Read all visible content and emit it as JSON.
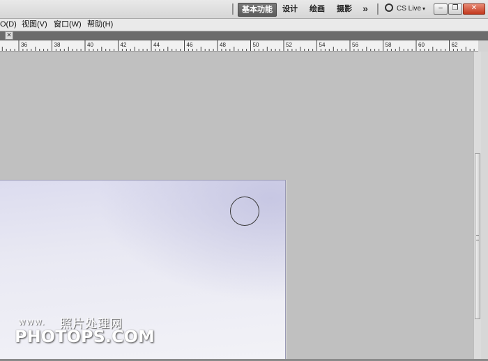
{
  "workspace_switcher": {
    "items": [
      {
        "label": "基本功能",
        "active": true
      },
      {
        "label": "设计",
        "active": false
      },
      {
        "label": "绘画",
        "active": false
      },
      {
        "label": "摄影",
        "active": false
      }
    ],
    "more_label": "»",
    "cs_live_label": "CS Live",
    "cs_live_caret": "▾"
  },
  "window_controls": {
    "minimize": "–",
    "restore": "❐",
    "close": "✕"
  },
  "menu": {
    "items": [
      {
        "label": "O(D)"
      },
      {
        "label": "视图(V)"
      },
      {
        "label": "窗口(W)"
      },
      {
        "label": "帮助(H)"
      }
    ]
  },
  "document_tab": {
    "close_glyph": "✕"
  },
  "ruler": {
    "labels": [
      "36",
      "38",
      "40",
      "42",
      "44",
      "46",
      "48",
      "50",
      "52",
      "54",
      "56",
      "58",
      "60",
      "62"
    ]
  },
  "watermark": {
    "www": "www.",
    "chinese": "照片处理网",
    "main": "PHOTOPS.COM"
  },
  "colors": {
    "workspace_bg": "#c0c0c0",
    "active_workspace": "#5c5c5c",
    "close_button": "#c2391e"
  },
  "icons": {
    "more": "double-chevron-right-icon",
    "cs_live": "ring-icon",
    "brush_cursor": "circle-brush-cursor-icon"
  }
}
